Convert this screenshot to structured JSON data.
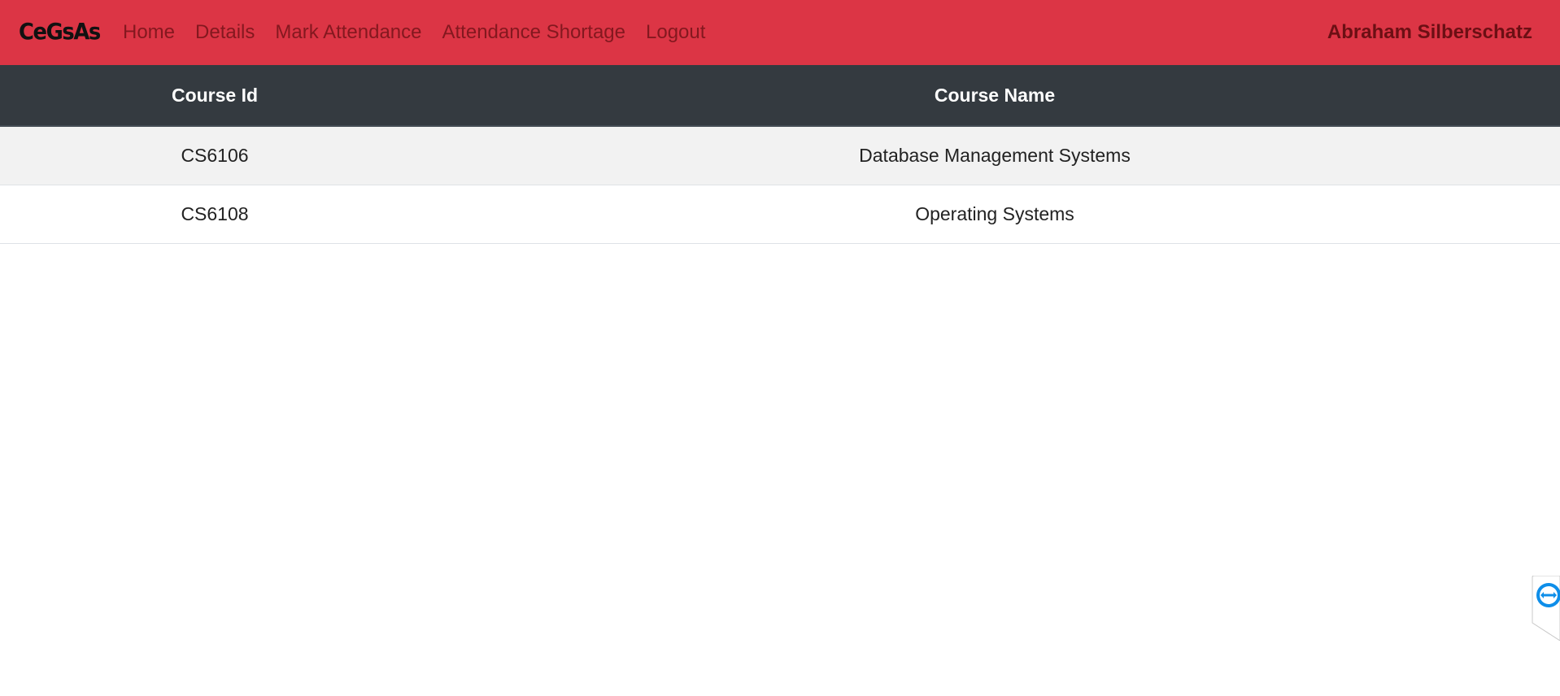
{
  "navbar": {
    "brand": "CeGsAs",
    "links": [
      {
        "label": "Home"
      },
      {
        "label": "Details"
      },
      {
        "label": "Mark Attendance"
      },
      {
        "label": "Attendance Shortage"
      },
      {
        "label": "Logout"
      }
    ],
    "user_name": "Abraham Silberschatz",
    "background_color": "#dc3545"
  },
  "table": {
    "headers": [
      "Course Id",
      "Course Name"
    ],
    "rows": [
      {
        "course_id": "CS6106",
        "course_name": "Database Management Systems"
      },
      {
        "course_id": "CS6108",
        "course_name": "Operating Systems"
      }
    ],
    "header_color": "#343a40"
  },
  "floating_widget": {
    "icon": "remote-support-icon",
    "color": "#0e8ee9"
  }
}
